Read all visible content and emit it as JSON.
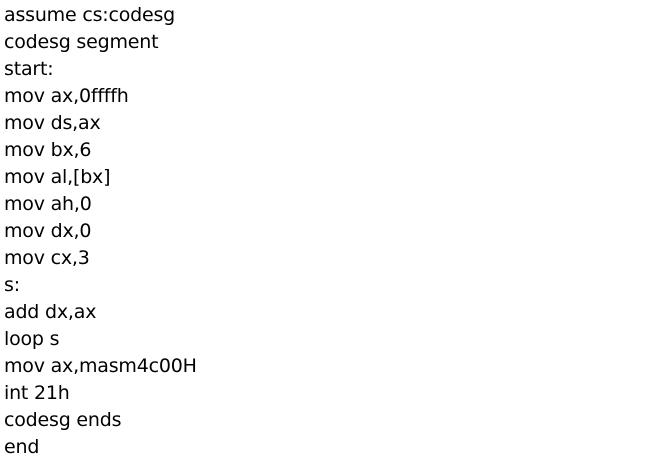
{
  "document": {
    "lines": [
      "assume cs:codesg",
      "codesg segment",
      "start:",
      "mov ax,0ffffh",
      "mov ds,ax",
      "mov bx,6",
      "mov al,[bx]",
      "mov ah,0",
      "mov dx,0",
      "mov cx,3",
      "s:",
      "add dx,ax",
      "loop s",
      "mov ax,masm4c00H",
      "int 21h",
      "codesg ends",
      "end"
    ]
  },
  "colors": {
    "text": "#000000",
    "background": "#ffffff"
  }
}
